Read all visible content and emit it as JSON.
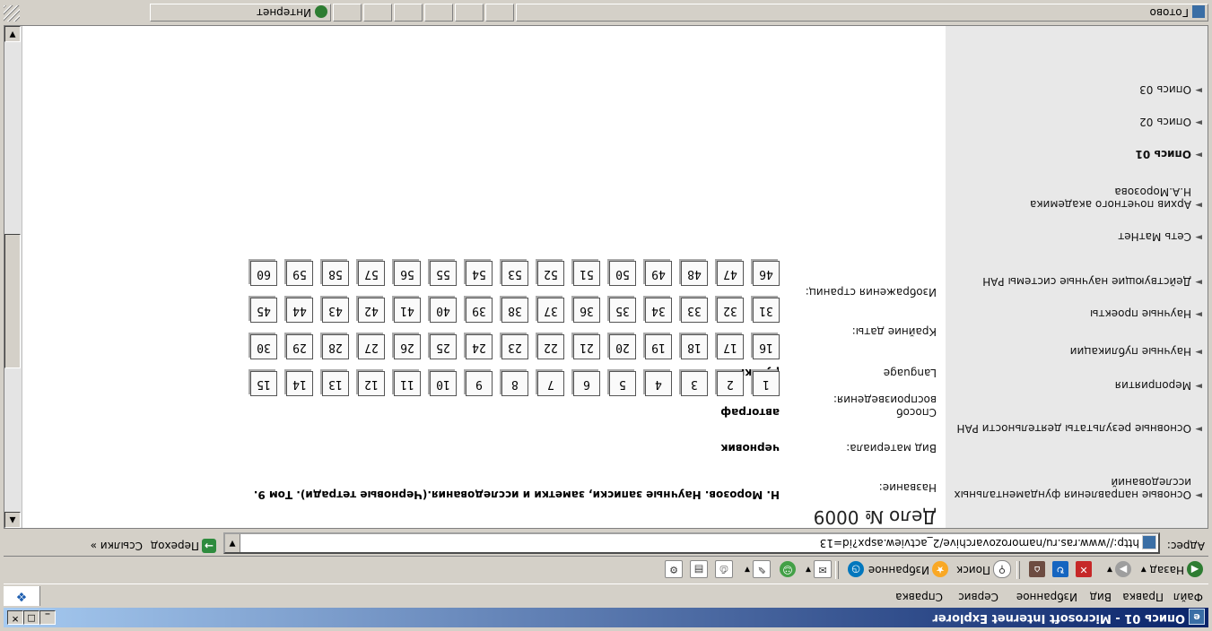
{
  "window": {
    "title": "Опись 01 - Microsoft Internet Explorer"
  },
  "menu": [
    "Файл",
    "Правка",
    "Вид",
    "Избранное",
    "Сервис",
    "Справка"
  ],
  "toolbar": {
    "back_label": "Назад",
    "search_label": "Поиск",
    "favorites_label": "Избранное"
  },
  "address": {
    "label": "Адрес:",
    "url": "http://www.ras.ru/namorozovarchive/2_actview.aspx?id=13",
    "go_label": "Переход",
    "links_label": "Ссылки"
  },
  "sidebar": {
    "items": [
      {
        "label": "Основые направления фундаментальных исследований",
        "bold": false
      },
      {
        "label": "Основные результаты деятельности РАН",
        "bold": false
      },
      {
        "label": "Мероприятия",
        "bold": false
      },
      {
        "label": "Научные публикации",
        "bold": false
      },
      {
        "label": "Научные проекты",
        "bold": false
      },
      {
        "label": "Действующие научные системы РАН",
        "bold": false
      },
      {
        "label": "Сеть МатНет",
        "bold": false
      },
      {
        "label": "Архив почетного академика Н.А.Морозова",
        "bold": false
      },
      {
        "label": "Опись 01",
        "bold": true
      },
      {
        "label": "Опись 02",
        "bold": false
      },
      {
        "label": "Опись 03",
        "bold": false
      }
    ]
  },
  "doc": {
    "title": "Дело № 0009",
    "fields": [
      {
        "label": "Название:",
        "value": "Н. Морозов. Научные записки, заметки и исследования.(Черновые тетради). Том 9."
      },
      {
        "label": "Вид материала:",
        "value": "черновик"
      },
      {
        "label": "Способ воспроизведения:",
        "value": "автограф"
      },
      {
        "label": "Language",
        "value": "русский"
      },
      {
        "label": "Крайние даты:",
        "value": ""
      },
      {
        "label": "Изображения страниц:",
        "value": ""
      }
    ],
    "pages": [
      [
        "1",
        "2",
        "3",
        "4",
        "5",
        "6",
        "7",
        "8",
        "9",
        "10",
        "11",
        "12",
        "13",
        "14",
        "15"
      ],
      [
        "16",
        "17",
        "18",
        "19",
        "20",
        "21",
        "22",
        "23",
        "24",
        "25",
        "26",
        "27",
        "28",
        "29",
        "30"
      ],
      [
        "31",
        "32",
        "33",
        "34",
        "35",
        "36",
        "37",
        "38",
        "39",
        "40",
        "41",
        "42",
        "43",
        "44",
        "45"
      ],
      [
        "46",
        "47",
        "48",
        "49",
        "50",
        "51",
        "52",
        "53",
        "54",
        "55",
        "56",
        "57",
        "58",
        "59",
        "60"
      ]
    ]
  },
  "status": {
    "left": "Готово",
    "zone": "Интернет"
  },
  "colors": {
    "titlebar_start": "#0a246a",
    "titlebar_end": "#a6caf0",
    "chrome": "#d4d0c8",
    "sidebar_bg": "#e8e8e8"
  }
}
